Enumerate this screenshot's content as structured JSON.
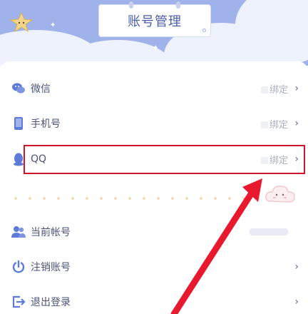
{
  "header": {
    "title": "账号管理"
  },
  "account_rows": [
    {
      "label": "微信",
      "value": "绑定",
      "icon": "wechat-icon",
      "color": "#5f7bd9"
    },
    {
      "label": "手机号",
      "value": "绑定",
      "icon": "phone-icon",
      "color": "#5f7bd9"
    },
    {
      "label": "QQ",
      "value": "绑定",
      "icon": "qq-icon",
      "color": "#5f7bd9"
    }
  ],
  "action_rows": [
    {
      "label": "当前帐号",
      "icon": "user-group-icon"
    },
    {
      "label": "注销账号",
      "icon": "power-icon"
    },
    {
      "label": "退出登录",
      "icon": "logout-icon"
    }
  ],
  "colors": {
    "header_bg": "#9fb3ea",
    "accent": "#5f7bd9",
    "highlight": "#d0142b",
    "arrow": "#e8192f"
  }
}
